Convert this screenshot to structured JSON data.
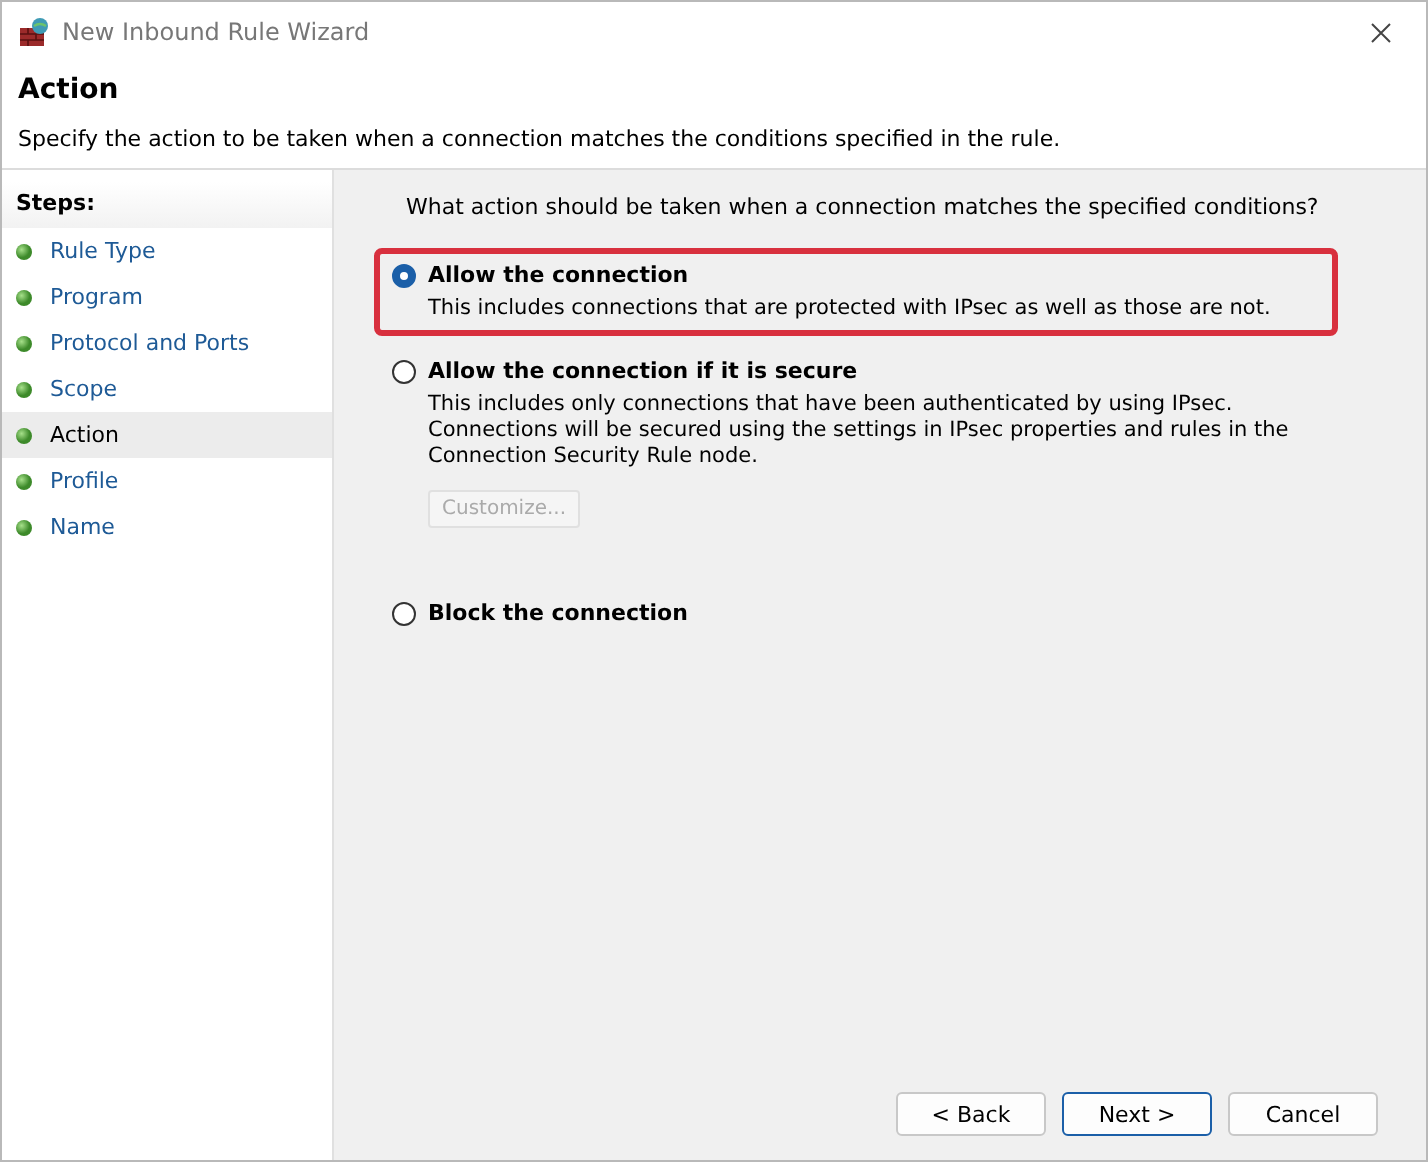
{
  "window": {
    "title": "New Inbound Rule Wizard"
  },
  "header": {
    "title": "Action",
    "description": "Specify the action to be taken when a connection matches the conditions specified in the rule."
  },
  "steps": {
    "heading": "Steps:",
    "items": [
      {
        "label": "Rule Type",
        "selected": false
      },
      {
        "label": "Program",
        "selected": false
      },
      {
        "label": "Protocol and Ports",
        "selected": false
      },
      {
        "label": "Scope",
        "selected": false
      },
      {
        "label": "Action",
        "selected": true
      },
      {
        "label": "Profile",
        "selected": false
      },
      {
        "label": "Name",
        "selected": false
      }
    ]
  },
  "question": "What action should be taken when a connection matches the specified conditions?",
  "options": [
    {
      "label": "Allow the connection",
      "description": "This includes connections that are protected with IPsec as well as those are not.",
      "selected": true,
      "highlighted": true
    },
    {
      "label": "Allow the connection if it is secure",
      "description": "This includes only connections that have been authenticated by using IPsec.  Connections will be secured using the settings in IPsec properties and rules in the Connection Security Rule node.",
      "selected": false,
      "highlighted": false,
      "button": {
        "label": "Customize...",
        "disabled": true
      }
    },
    {
      "label": "Block the connection",
      "selected": false,
      "highlighted": false
    }
  ],
  "buttons": [
    {
      "label": "< Back",
      "default": false
    },
    {
      "label": "Next >",
      "default": true
    },
    {
      "label": "Cancel",
      "default": false
    }
  ]
}
